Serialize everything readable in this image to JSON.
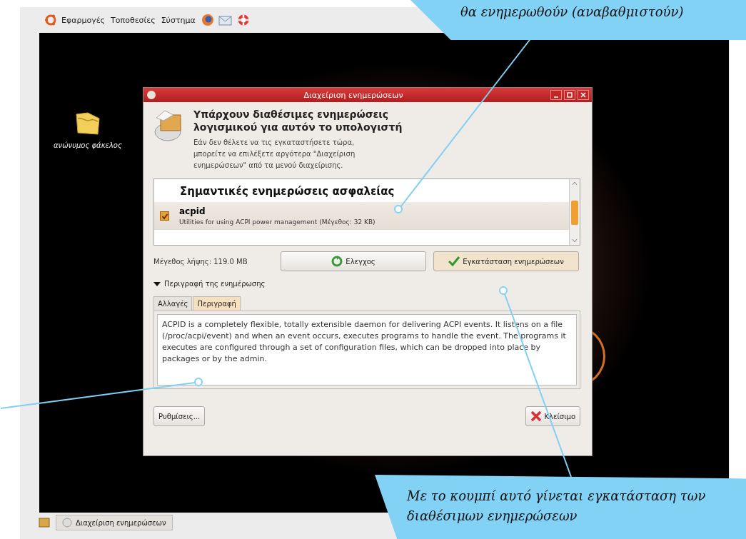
{
  "top_panel": {
    "menus": [
      "Εφαρμογές",
      "Τοποθεσίες",
      "Σύστημα"
    ]
  },
  "desktop_icons": [
    {
      "label": "ανώνυμος φάκελος"
    }
  ],
  "window": {
    "title": "Διαχείριση ενημερώσεων",
    "heading": "Υπάρχουν διαθέσιμες ενημερώσεις λογισμικού για αυτόν το υπολογιστή",
    "subtext": "Εάν δεν θέλετε να τις εγκαταστήσετε τώρα, μπορείτε να επιλέξετε αργότερα \"Διαχείριση ενημερώσεων\" από τα μενού διαχείρισης.",
    "update_list": {
      "group": "Σημαντικές ενημερώσεις ασφαλείας",
      "items": [
        {
          "name": "acpid",
          "description": "Utilities for using ACPI power management (Μέγεθος: 32 KB)",
          "checked": true
        }
      ]
    },
    "download_size": "Μέγεθος λήψης: 119.0 MB",
    "check_button": "Ελεγχος",
    "install_button": "Εγκατάσταση ενημερώσεων",
    "expander": {
      "label": "Περιγραφή της ενημέρωσης",
      "expanded": true
    },
    "tabs": [
      {
        "label": "Αλλαγές",
        "selected": false
      },
      {
        "label": "Περιγραφή",
        "selected": true
      }
    ],
    "description_text": "ACPID is a completely flexible, totally extensible daemon for delivering ACPI events. It listens on a file (/proc/acpi/event) and when an event occurs, executes programs to handle the event. The programs it executes are configured through a set of configuration files, which can be dropped into place by packages or by the admin.",
    "settings_button": "Ρυθμίσεις...",
    "close_button": "Κλείσιμο"
  },
  "taskbar": {
    "items": [
      "Διαχείριση ενημερώσεων"
    ]
  },
  "callouts": [
    {
      "text": "θα ενημερωθούν (αναβαθμιστούν)",
      "kind": "top"
    },
    {
      "text": "Με το κουμπί αυτό γίνεται εγκατάσταση των διαθέσιμων ενημερώσεων",
      "kind": "bottom"
    }
  ]
}
